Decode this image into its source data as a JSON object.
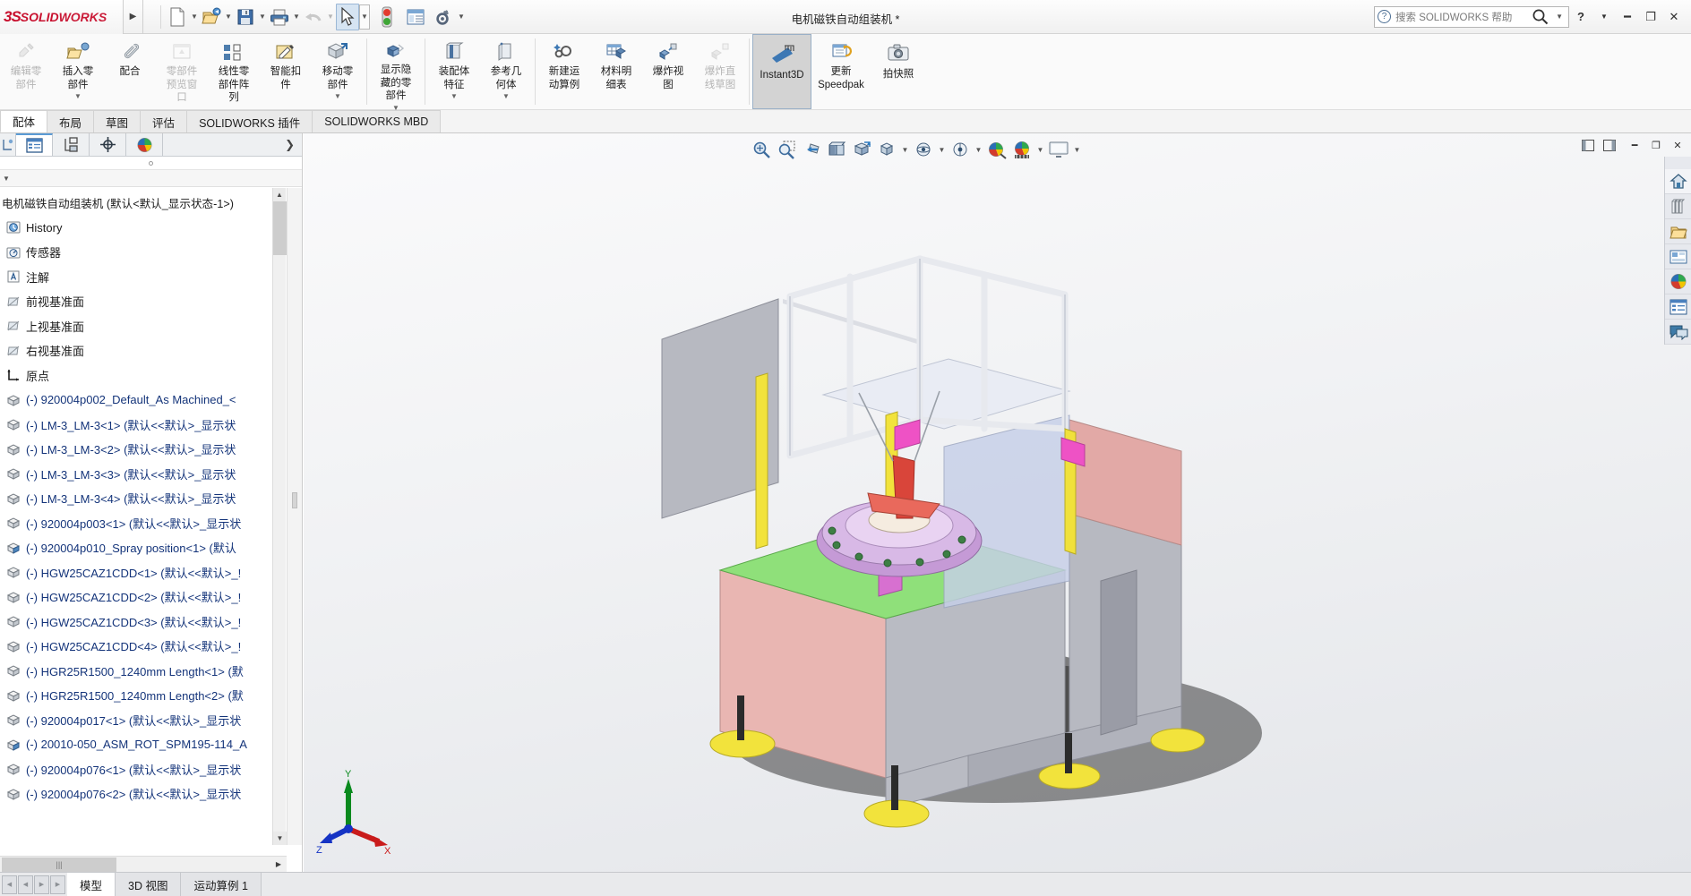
{
  "app": {
    "brand_3ds": "3S",
    "brand_solid": "SOLID",
    "brand_works": "WORKS",
    "document_title": "电机磁铁自动组装机 *",
    "accent_red": "#c8102e",
    "accent_blue": "#14347a",
    "selected_button_bg": "#d6e4f2"
  },
  "titlebar": {
    "expander_icon": "chevron-right-icon",
    "quick_tools": [
      {
        "name": "new-document",
        "icon": "new-file-icon",
        "has_caret": true
      },
      {
        "name": "open-document",
        "icon": "open-folder-icon",
        "has_caret": true
      },
      {
        "name": "save-document",
        "icon": "floppy-save-icon",
        "has_caret": true
      },
      {
        "name": "print-document",
        "icon": "printer-icon",
        "has_caret": true
      },
      {
        "name": "undo",
        "icon": "undo-arrow-icon",
        "has_caret": true,
        "disabled": true
      },
      {
        "name": "select",
        "icon": "mouse-cursor-icon",
        "has_caret": true,
        "selected": true
      },
      {
        "name": "rebuild-status",
        "icon": "traffic-light-icon",
        "has_caret": false
      },
      {
        "name": "file-properties",
        "icon": "properties-table-icon",
        "has_caret": false
      },
      {
        "name": "options",
        "icon": "gear-icon",
        "has_caret": true
      }
    ],
    "search": {
      "help_icon": "question-circle-icon",
      "placeholder": "搜索 SOLIDWORKS 帮助",
      "magnifier_icon": "magnifier-icon",
      "dropdown_icon": "chevron-down-icon"
    },
    "help_label": "?",
    "window_controls": [
      "minimize",
      "maximize",
      "close"
    ]
  },
  "ribbon": {
    "groups": [
      {
        "buttons": [
          {
            "label": "编辑零\n部件",
            "label_line1": "编辑零",
            "label_line2": "部件",
            "icon": "edit-component-icon",
            "disabled": true,
            "name": "edit-component-button"
          },
          {
            "label_line1": "插入零",
            "label_line2": "部件",
            "icon": "insert-component-icon",
            "disabled": false,
            "caret": true,
            "name": "insert-component-button"
          },
          {
            "label_line1": "配合",
            "label_line2": "",
            "icon": "mate-paperclip-icon",
            "disabled": false,
            "name": "mate-button"
          },
          {
            "label_line1": "零部件",
            "label_line2": "预览窗",
            "label_line3": "口",
            "icon": "component-preview-window-icon",
            "disabled": true,
            "name": "component-preview-window-button"
          },
          {
            "label_line1": "线性零",
            "label_line2": "部件阵",
            "label_line3": "列",
            "icon": "linear-component-pattern-icon",
            "disabled": false,
            "caret": true,
            "name": "linear-component-pattern-button"
          },
          {
            "label_line1": "智能扣",
            "label_line2": "件",
            "icon": "smart-fasteners-icon",
            "disabled": false,
            "name": "smart-fasteners-button"
          },
          {
            "label_line1": "移动零",
            "label_line2": "部件",
            "icon": "move-component-icon",
            "disabled": false,
            "caret": true,
            "name": "move-component-button"
          }
        ]
      },
      {
        "buttons": [
          {
            "label_line1": "显示隐",
            "label_line2": "藏的零",
            "label_line3": "部件",
            "icon": "show-hidden-components-icon",
            "disabled": false,
            "caret": true,
            "name": "show-hidden-components-button"
          }
        ]
      },
      {
        "buttons": [
          {
            "label_line1": "装配体",
            "label_line2": "特征",
            "icon": "assembly-feature-icon",
            "disabled": false,
            "caret": true,
            "name": "assembly-features-button"
          },
          {
            "label_line1": "参考几",
            "label_line2": "何体",
            "icon": "reference-geometry-icon",
            "disabled": false,
            "caret": true,
            "name": "reference-geometry-button"
          }
        ]
      },
      {
        "buttons": [
          {
            "label_line1": "新建运",
            "label_line2": "动算例",
            "icon": "new-motion-study-icon",
            "disabled": false,
            "name": "new-motion-study-button"
          },
          {
            "label_line1": "材料明",
            "label_line2": "细表",
            "icon": "bill-of-materials-icon",
            "disabled": false,
            "name": "bill-of-materials-button"
          },
          {
            "label_line1": "爆炸视",
            "label_line2": "图",
            "icon": "exploded-view-icon",
            "disabled": false,
            "name": "exploded-view-button"
          },
          {
            "label_line1": "爆炸直",
            "label_line2": "线草图",
            "icon": "explode-line-sketch-icon",
            "disabled": true,
            "name": "explode-line-sketch-button"
          }
        ]
      },
      {
        "buttons": [
          {
            "label_line1": "Instant3D",
            "label_line2": "",
            "icon": "instant3d-arrow-icon",
            "disabled": false,
            "active": true,
            "name": "instant3d-button"
          },
          {
            "label_line1": "更新",
            "label_line2": "Speedpak",
            "icon": "update-speedpak-icon",
            "disabled": false,
            "name": "update-speedpak-button"
          },
          {
            "label_line1": "拍快照",
            "label_line2": "",
            "icon": "camera-snapshot-icon",
            "disabled": false,
            "name": "take-snapshot-button"
          }
        ]
      }
    ]
  },
  "command_tabs": [
    {
      "label": "配体",
      "active": true,
      "name": "tab-assembly"
    },
    {
      "label": "布局",
      "active": false,
      "name": "tab-layout"
    },
    {
      "label": "草图",
      "active": false,
      "name": "tab-sketch"
    },
    {
      "label": "评估",
      "active": false,
      "name": "tab-evaluate"
    },
    {
      "label": "SOLIDWORKS 插件",
      "active": false,
      "name": "tab-solidworks-addins"
    },
    {
      "label": "SOLIDWORKS MBD",
      "active": false,
      "name": "tab-solidworks-mbd"
    }
  ],
  "feature_manager": {
    "tabs": [
      {
        "name": "feature-tree-tab",
        "icon": "feature-tree-icon",
        "active": false
      },
      {
        "name": "property-manager-tab",
        "icon": "property-list-icon",
        "active": true
      },
      {
        "name": "configuration-manager-tab",
        "icon": "configuration-icon",
        "active": false
      },
      {
        "name": "dimxpert-manager-tab",
        "icon": "dimxpert-target-icon",
        "active": false
      },
      {
        "name": "display-manager-tab",
        "icon": "display-palette-icon",
        "active": false
      }
    ],
    "expand_icon": "chevron-right-icon",
    "filter_caret_icon": "chevron-down-icon",
    "root": "电机磁铁自动组装机  (默认<默认_显示状态-1>)",
    "items": [
      {
        "label": "History",
        "icon": "history-icon",
        "color": "dark"
      },
      {
        "label": "传感器",
        "icon": "sensors-icon",
        "color": "dark"
      },
      {
        "label": "注解",
        "icon": "annotations-icon",
        "color": "dark"
      },
      {
        "label": "前视基准面",
        "icon": "front-plane-icon",
        "color": "dark"
      },
      {
        "label": "上视基准面",
        "icon": "top-plane-icon",
        "color": "dark"
      },
      {
        "label": "右视基准面",
        "icon": "right-plane-icon",
        "color": "dark"
      },
      {
        "label": "原点",
        "icon": "origin-icon",
        "color": "dark"
      },
      {
        "label": "(-) 920004p002_Default_As Machined_<",
        "icon": "component-icon",
        "color": "blue"
      },
      {
        "label": "(-) LM-3_LM-3<1> (默认<<默认>_显示状",
        "icon": "component-icon",
        "color": "blue"
      },
      {
        "label": "(-) LM-3_LM-3<2> (默认<<默认>_显示状",
        "icon": "component-icon",
        "color": "blue"
      },
      {
        "label": "(-) LM-3_LM-3<3> (默认<<默认>_显示状",
        "icon": "component-icon",
        "color": "blue"
      },
      {
        "label": "(-) LM-3_LM-3<4> (默认<<默认>_显示状",
        "icon": "component-icon",
        "color": "blue"
      },
      {
        "label": "(-) 920004p003<1> (默认<<默认>_显示状",
        "icon": "component-icon",
        "color": "blue"
      },
      {
        "label": "(-) 920004p010_Spray position<1> (默认",
        "icon": "subassembly-icon",
        "color": "blue"
      },
      {
        "label": "(-) HGW25CAZ1CDD<1> (默认<<默认>_!",
        "icon": "component-icon",
        "color": "blue"
      },
      {
        "label": "(-) HGW25CAZ1CDD<2> (默认<<默认>_!",
        "icon": "component-icon",
        "color": "blue"
      },
      {
        "label": "(-) HGW25CAZ1CDD<3> (默认<<默认>_!",
        "icon": "component-icon",
        "color": "blue"
      },
      {
        "label": "(-) HGW25CAZ1CDD<4> (默认<<默认>_!",
        "icon": "component-icon",
        "color": "blue"
      },
      {
        "label": "(-) HGR25R1500_1240mm Length<1> (默",
        "icon": "component-icon",
        "color": "blue"
      },
      {
        "label": "(-) HGR25R1500_1240mm Length<2> (默",
        "icon": "component-icon",
        "color": "blue"
      },
      {
        "label": "(-) 920004p017<1> (默认<<默认>_显示状",
        "icon": "component-icon",
        "color": "blue"
      },
      {
        "label": "(-) 20010-050_ASM_ROT_SPM195-114_A",
        "icon": "subassembly-icon",
        "color": "blue"
      },
      {
        "label": "(-) 920004p076<1> (默认<<默认>_显示状",
        "icon": "component-icon",
        "color": "blue"
      },
      {
        "label": "(-) 920004p076<2> (默认<<默认>_显示状",
        "icon": "component-icon",
        "color": "blue"
      }
    ],
    "hscroll_grip": "|||",
    "hscroll_right_icon": "triangle-right-icon"
  },
  "view_toolbar": [
    {
      "name": "zoom-to-fit-button",
      "icon": "zoom-to-fit-icon",
      "caret": false
    },
    {
      "name": "zoom-to-area-button",
      "icon": "zoom-to-area-icon",
      "caret": false
    },
    {
      "name": "previous-view-button",
      "icon": "previous-view-icon",
      "caret": false
    },
    {
      "name": "section-view-button",
      "icon": "section-view-icon",
      "caret": false
    },
    {
      "name": "view-orientation-button",
      "icon": "view-orientation-icon",
      "caret": false
    },
    {
      "name": "display-style-button",
      "icon": "display-style-cube-icon",
      "caret": true
    },
    {
      "name": "hide-show-items-button",
      "icon": "hide-show-cube-icon",
      "caret": true
    },
    {
      "name": "view-settings-button",
      "icon": "eye-settings-icon",
      "caret": true
    },
    {
      "name": "apply-scene-button",
      "icon": "apply-scene-palette-icon",
      "caret": false
    },
    {
      "name": "view-setting-palette-button",
      "icon": "scene-palette-icon",
      "caret": true
    },
    {
      "name": "viewport-button",
      "icon": "monitor-viewport-icon",
      "caret": true
    }
  ],
  "graphics_window_controls": [
    {
      "name": "collapse-left-panel",
      "icon": "panel-left-icon"
    },
    {
      "name": "expand-panel",
      "icon": "panel-right-icon"
    },
    {
      "name": "minimize-document",
      "icon": "minimize-icon"
    },
    {
      "name": "restore-document",
      "icon": "restore-icon"
    },
    {
      "name": "close-document",
      "icon": "close-icon"
    }
  ],
  "right_dock": [
    {
      "name": "task-pane-home-button",
      "icon": "home-icon"
    },
    {
      "name": "design-library-button",
      "icon": "design-library-icon"
    },
    {
      "name": "file-explorer-button",
      "icon": "folder-icon"
    },
    {
      "name": "view-palette-button",
      "icon": "view-palette-icon"
    },
    {
      "name": "appearances-scenes-button",
      "icon": "appearances-palette-icon"
    },
    {
      "name": "custom-properties-button",
      "icon": "custom-properties-icon"
    },
    {
      "name": "solidworks-forum-button",
      "icon": "forum-chat-icon"
    }
  ],
  "triad": {
    "x_label": "X",
    "y_label": "Y",
    "z_label": "Z"
  },
  "model_tabs": {
    "nav_icons": [
      "first-icon",
      "prev-icon",
      "next-icon",
      "last-icon"
    ],
    "tabs": [
      {
        "label": "模型",
        "active": true,
        "name": "model-tab"
      },
      {
        "label": "3D 视图",
        "active": false,
        "name": "3d-views-tab"
      },
      {
        "label": "运动算例 1",
        "active": false,
        "name": "motion-study-1-tab"
      }
    ]
  }
}
